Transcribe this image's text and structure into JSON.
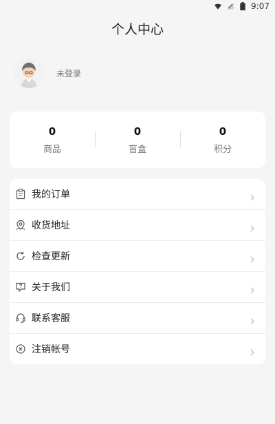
{
  "status": {
    "time": "9:07"
  },
  "title": "个人中心",
  "profile": {
    "login_text": "未登录"
  },
  "stats": [
    {
      "value": "0",
      "label": "商品"
    },
    {
      "value": "0",
      "label": "盲盒"
    },
    {
      "value": "0",
      "label": "积分"
    }
  ],
  "menu": [
    {
      "label": "我的订单",
      "icon": "clipboard-icon"
    },
    {
      "label": "收货地址",
      "icon": "location-pin-icon"
    },
    {
      "label": "检查更新",
      "icon": "refresh-icon"
    },
    {
      "label": "关于我们",
      "icon": "question-chat-icon"
    },
    {
      "label": "联系客服",
      "icon": "headset-icon"
    },
    {
      "label": "注销帐号",
      "icon": "close-circle-icon"
    }
  ]
}
